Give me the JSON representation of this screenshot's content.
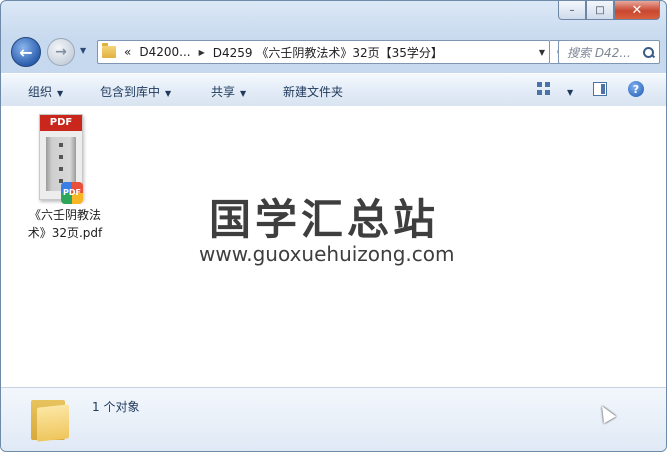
{
  "window": {
    "minimize_glyph": "–",
    "maximize_glyph": "□",
    "close_glyph": "✕"
  },
  "nav": {
    "back_glyph": "←",
    "forward_glyph": "→"
  },
  "address": {
    "breadcrumbs": [
      "«",
      "D4200...",
      "D4259 《六壬阴教法术》32页【35学分】"
    ],
    "refresh_glyph": "⟳"
  },
  "search": {
    "placeholder": "搜索 D42..."
  },
  "toolbar": {
    "organize": "组织",
    "include_library": "包含到库中",
    "share": "共享",
    "new_folder": "新建文件夹",
    "help_glyph": "?"
  },
  "files": [
    {
      "name_line1": "《六壬阴教法",
      "name_line2": "术》32页.pdf",
      "thumb_label": "PDF",
      "badge_label": "PDF"
    }
  ],
  "watermark": {
    "title": "国学汇总站",
    "url": "www.guoxuehuizong.com"
  },
  "status": {
    "count_text": "1 个对象"
  },
  "colors": {
    "accent": "#2c5fae",
    "pdf_red": "#c9261c"
  }
}
